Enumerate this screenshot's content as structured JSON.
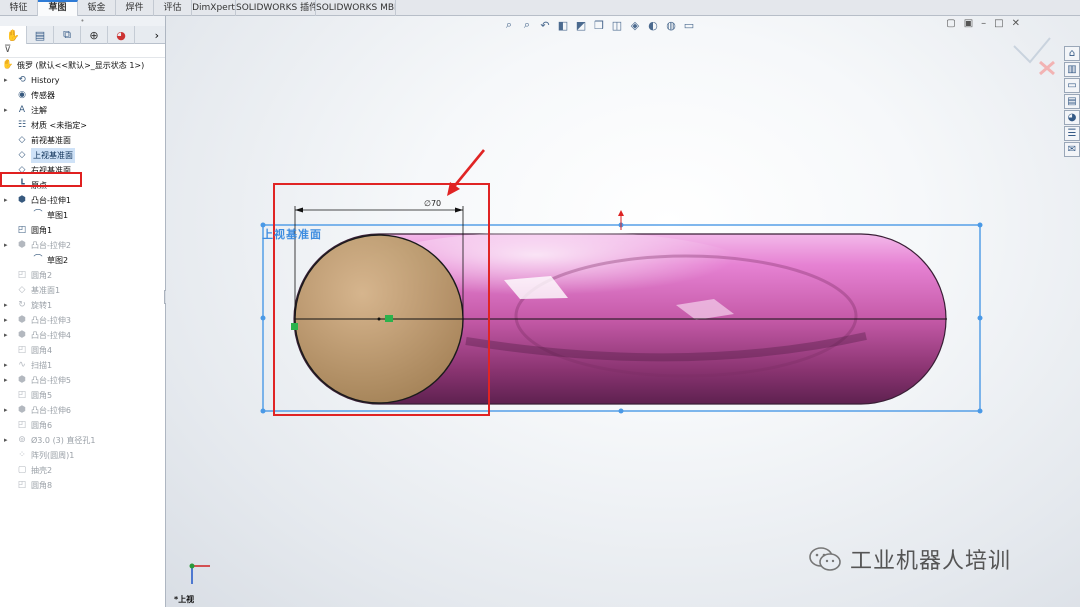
{
  "command_tabs": [
    "特征",
    "草图",
    "钣金",
    "焊件",
    "评估",
    "DimXpert",
    "SOLIDWORKS 插件",
    "SOLIDWORKS MBD"
  ],
  "active_tab_index": 1,
  "panel": {
    "tabs": [
      "feature-manager-icon",
      "property-manager-icon",
      "configuration-manager-icon",
      "dimxpert-manager-icon",
      "display-manager-icon"
    ],
    "tree": [
      {
        "label": "俄罗 (默认<<默认>_显示状态 1>)",
        "icon": "part-icon",
        "level": 0
      },
      {
        "label": "History",
        "icon": "history-icon",
        "level": 1,
        "expand": true
      },
      {
        "label": "传感器",
        "icon": "sensor-icon",
        "level": 1
      },
      {
        "label": "注解",
        "icon": "annotation-icon",
        "level": 1,
        "expand": true
      },
      {
        "label": "材质 <未指定>",
        "icon": "material-icon",
        "level": 1
      },
      {
        "label": "前视基准面",
        "icon": "plane-icon",
        "level": 1
      },
      {
        "label": "上视基准面",
        "icon": "plane-icon",
        "level": 1,
        "selected": true
      },
      {
        "label": "右视基准面",
        "icon": "plane-icon",
        "level": 1
      },
      {
        "label": "原点",
        "icon": "origin-icon",
        "level": 1
      },
      {
        "label": "凸台-拉伸1",
        "icon": "extrude-icon",
        "level": 1,
        "expand": true
      },
      {
        "label": "草图1",
        "icon": "sketch-icon",
        "level": 2
      },
      {
        "label": "圆角1",
        "icon": "fillet-icon",
        "level": 1
      },
      {
        "label": "凸台-拉伸2",
        "icon": "extrude-icon",
        "level": 1,
        "expand": true,
        "dim": true
      },
      {
        "label": "草图2",
        "icon": "sketch-icon",
        "level": 2
      },
      {
        "label": "圆角2",
        "icon": "fillet-icon",
        "level": 1,
        "dim": true
      },
      {
        "label": "基准面1",
        "icon": "plane-icon",
        "level": 1,
        "dim": true
      },
      {
        "label": "旋转1",
        "icon": "revolve-icon",
        "level": 1,
        "expand": true,
        "dim": true
      },
      {
        "label": "凸台-拉伸3",
        "icon": "extrude-icon",
        "level": 1,
        "expand": true,
        "dim": true
      },
      {
        "label": "凸台-拉伸4",
        "icon": "extrude-icon",
        "level": 1,
        "expand": true,
        "dim": true
      },
      {
        "label": "圆角4",
        "icon": "fillet-icon",
        "level": 1,
        "dim": true
      },
      {
        "label": "扫描1",
        "icon": "sweep-icon",
        "level": 1,
        "expand": true,
        "dim": true
      },
      {
        "label": "凸台-拉伸5",
        "icon": "extrude-icon",
        "level": 1,
        "expand": true,
        "dim": true
      },
      {
        "label": "圆角5",
        "icon": "fillet-icon",
        "level": 1,
        "dim": true
      },
      {
        "label": "凸台-拉伸6",
        "icon": "extrude-icon",
        "level": 1,
        "expand": true,
        "dim": true
      },
      {
        "label": "圆角6",
        "icon": "fillet-icon",
        "level": 1,
        "dim": true
      },
      {
        "label": "Ø3.0 (3) 直径孔1",
        "icon": "hole-icon",
        "level": 1,
        "expand": true,
        "dim": true
      },
      {
        "label": "阵列(圆周)1",
        "icon": "pattern-icon",
        "level": 1,
        "dim": true
      },
      {
        "label": "抽壳2",
        "icon": "shell-icon",
        "level": 1,
        "dim": true
      },
      {
        "label": "圆角8",
        "icon": "fillet-icon",
        "level": 1,
        "dim": true
      }
    ]
  },
  "viewport": {
    "plane_label": "上视基准面",
    "dimension_text": "∅70",
    "view_label": "上视",
    "triad_axes": [
      "X",
      "Z"
    ],
    "body_color": "#c04aa0",
    "sketch_fill": "#b89a6a"
  },
  "watermark": "工业机器人培训"
}
